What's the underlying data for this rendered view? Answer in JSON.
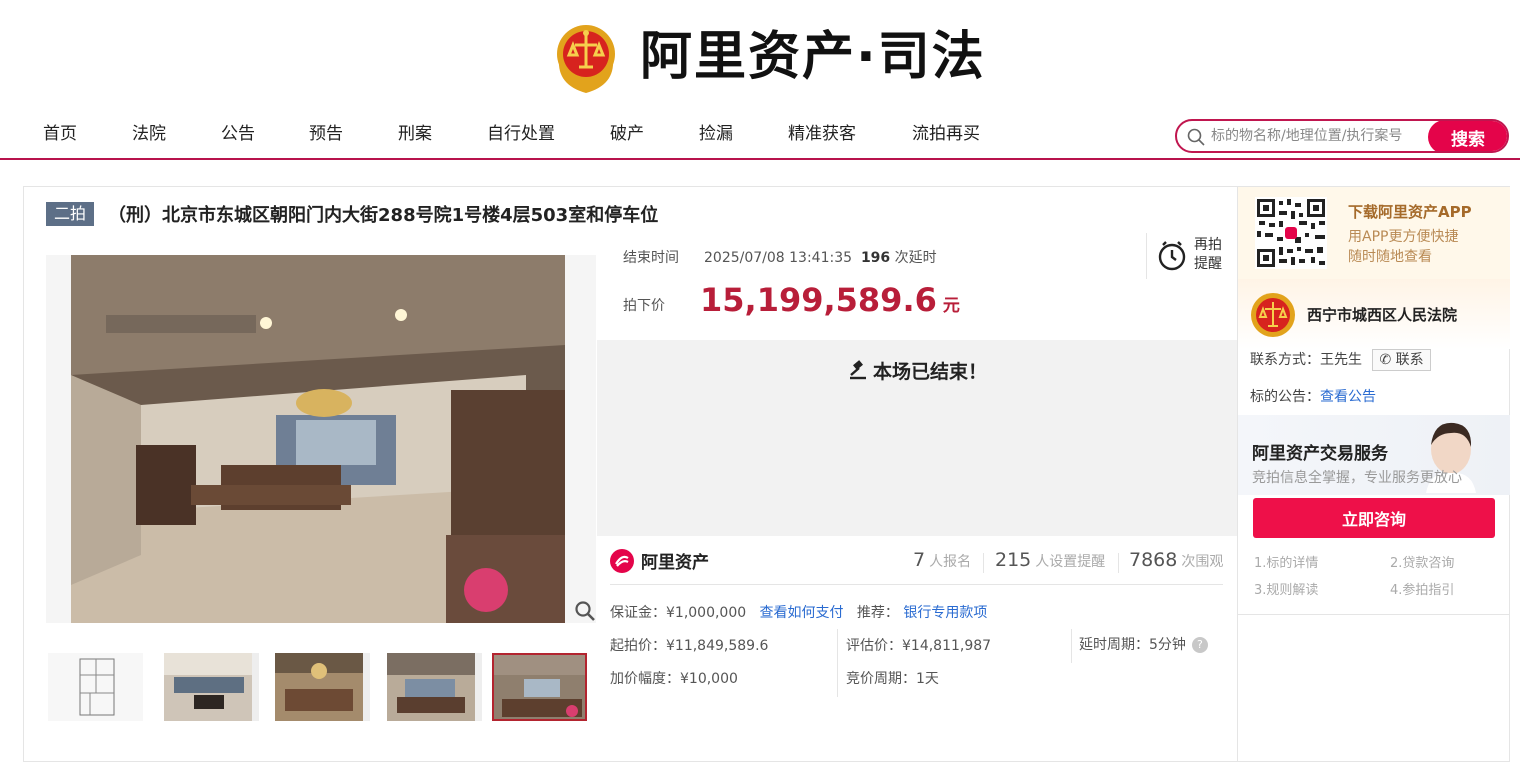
{
  "header": {
    "brand": "阿里资产·司法"
  },
  "nav": {
    "items": [
      "首页",
      "法院",
      "公告",
      "预告",
      "刑案",
      "自行处置",
      "破产",
      "捡漏",
      "精准获客",
      "流拍再买"
    ],
    "search_placeholder": "标的物名称/地理位置/执行案号",
    "search_button": "搜索"
  },
  "item": {
    "round_badge": "二拍",
    "title": "（刑）北京市东城区朝阳门内大街288号院1号楼4层503室和停车位",
    "end_label": "结束时间",
    "end_time": "2025/07/08 13:41:35",
    "delay_count": "196",
    "delay_text": "次延时",
    "remind_label": "再拍提醒",
    "price_label": "拍下价",
    "price": "15,199,589.6",
    "price_unit": "元",
    "ended_text": "本场已结束！",
    "thumbnail_count": 5,
    "active_thumbnail": 5
  },
  "stats": {
    "platform": "阿里资产",
    "signups": "7",
    "signups_label": "人报名",
    "reminders": "215",
    "reminders_label": "人设置提醒",
    "views": "7868",
    "views_label": "次围观"
  },
  "details": {
    "deposit_label": "保证金：",
    "deposit": "¥1,000,000",
    "how_to_pay": "查看如何支付",
    "recommend_label": "推荐：",
    "recommend_link": "银行专用款项",
    "start_price_label": "起拍价：",
    "start_price": "¥11,849,589.6",
    "assess_label": "评估价：",
    "assess_price": "¥14,811,987",
    "delay_period_label": "延时周期：",
    "delay_period": "5分钟",
    "increment_label": "加价幅度：",
    "increment": "¥10,000",
    "cycle_label": "竞价周期：",
    "cycle": "1天"
  },
  "sidebar": {
    "app_title": "下载阿里资产APP",
    "app_desc_1": "用APP更方便快捷",
    "app_desc_2": "随时随地查看",
    "court_name": "西宁市城西区人民法院",
    "contact_label": "联系方式：",
    "contact_person": "王先生",
    "contact_button": "联系",
    "notice_label": "标的公告：",
    "notice_link": "查看公告",
    "service_title": "阿里资产交易服务",
    "service_sub": "竞拍信息全掌握，专业服务更放心",
    "consult_button": "立即咨询",
    "help_links": [
      "1.标的详情",
      "2.贷款咨询",
      "3.规则解读",
      "4.参拍指引"
    ]
  }
}
